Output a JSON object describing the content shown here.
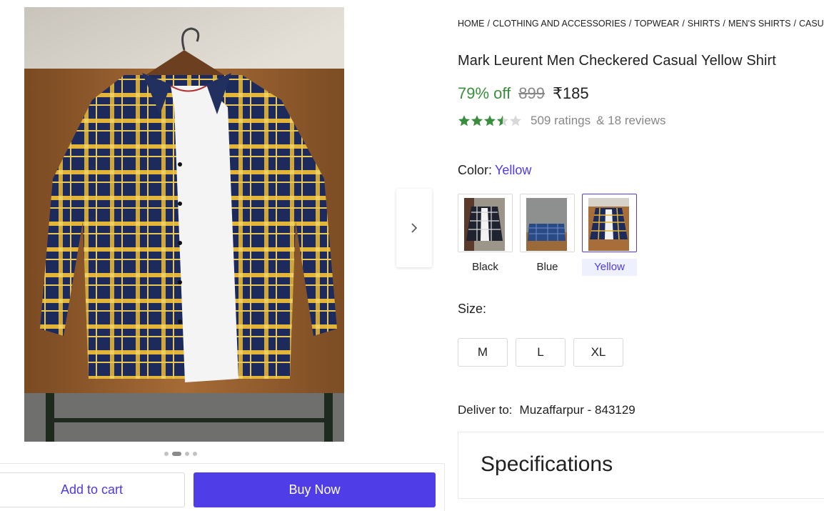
{
  "breadcrumb": [
    "HOME",
    "CLOTHING AND ACCESSORIES",
    "TOPWEAR",
    "SHIRTS",
    "MEN'S SHIRTS",
    "CASUAL SHIRTS"
  ],
  "product": {
    "title": "Mark Leurent Men Checkered Casual Yellow Shirt",
    "discount": "79% off",
    "mrp": "899",
    "price": "₹185",
    "rating_value": 3.5,
    "ratings_text": "509 ratings",
    "reviews_text": "& 18 reviews"
  },
  "color": {
    "label": "Color:",
    "selected": "Yellow",
    "options": [
      {
        "label": "Black"
      },
      {
        "label": "Blue"
      },
      {
        "label": "Yellow"
      }
    ]
  },
  "size": {
    "label": "Size:",
    "options": [
      "M",
      "L",
      "XL"
    ]
  },
  "delivery": {
    "label": "Deliver to:",
    "location": "Muzaffarpur - 843129"
  },
  "specifications": {
    "title": "Specifications"
  },
  "gallery": {
    "image_count": 4,
    "active_index": 1
  },
  "actions": {
    "add_to_cart": "Add to cart",
    "buy_now": "Buy Now"
  },
  "colors": {
    "accent": "#4e3ae0",
    "discount_green": "#388e3c",
    "star_green": "#388e3c",
    "muted": "#878787"
  },
  "icons": {
    "next": "chevron-right-icon",
    "star": "star-icon"
  }
}
